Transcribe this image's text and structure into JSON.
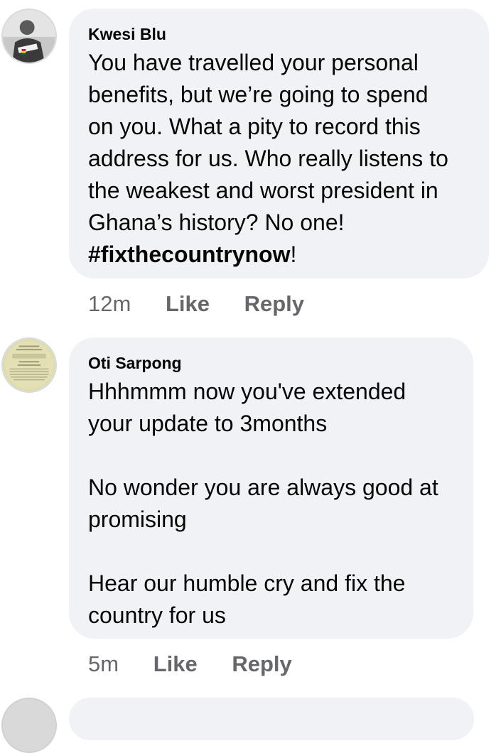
{
  "comments": [
    {
      "author": "Kwesi Blu",
      "lines": [
        "You have travelled your personal",
        "benefits, but we’re going to spend",
        "on you. What a pity to record this",
        "address for us. Who really listens to",
        "the weakest and worst president in",
        "Ghana’s history? No one!"
      ],
      "hashtag": "#fixthecountrynow",
      "hashtag_suffix": "!",
      "time": "12m",
      "like_label": "Like",
      "reply_label": "Reply",
      "avatar_icon": "person-photo-avatar"
    },
    {
      "author": "Oti Sarpong",
      "lines": [
        "Hhhmmm now you've extended",
        "your update to 3months",
        "",
        "No wonder you are always good at",
        "promising",
        "",
        "Hear our humble cry and fix the",
        "country for us"
      ],
      "time": "5m",
      "like_label": "Like",
      "reply_label": "Reply",
      "avatar_icon": "quote-image-avatar"
    }
  ],
  "colors": {
    "bubble": "#f0f2f5",
    "text": "#050505",
    "meta": "#65676b"
  }
}
